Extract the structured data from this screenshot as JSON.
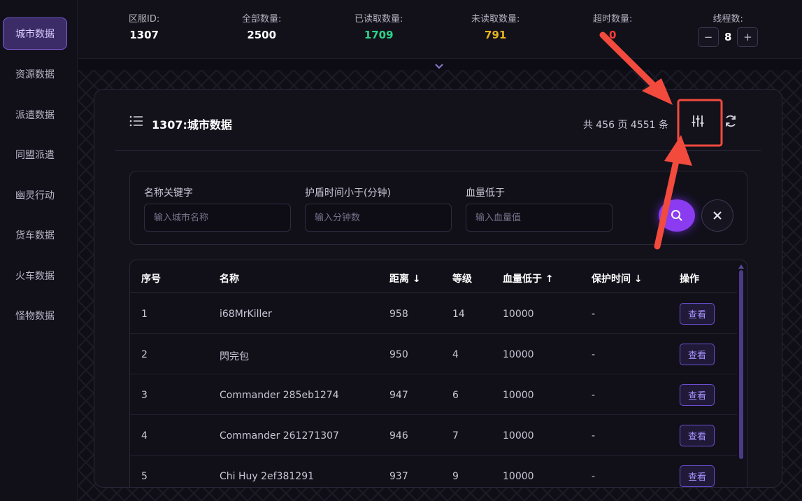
{
  "sidebar": {
    "items": [
      {
        "label": "城市数据",
        "active": true
      },
      {
        "label": "资源数据"
      },
      {
        "label": "派遣数据"
      },
      {
        "label": "同盟派遣"
      },
      {
        "label": "幽灵行动"
      },
      {
        "label": "货车数据"
      },
      {
        "label": "火车数据"
      },
      {
        "label": "怪物数据"
      }
    ]
  },
  "stats": {
    "server_id": {
      "label": "区服ID:",
      "value": "1307"
    },
    "total": {
      "label": "全部数量:",
      "value": "2500"
    },
    "read": {
      "label": "已读取数量:",
      "value": "1709"
    },
    "unread": {
      "label": "未读取数量:",
      "value": "791"
    },
    "timeout": {
      "label": "超时数量:",
      "value": "0"
    },
    "threads": {
      "label": "线程数:",
      "value": "8",
      "minus": "−",
      "plus": "+"
    }
  },
  "card": {
    "title": "1307:城市数据",
    "pager_info": "共 456 页 4551 条"
  },
  "filters": {
    "name": {
      "label": "名称关键字",
      "placeholder": "输入城市名称"
    },
    "shield": {
      "label": "护盾时间小于(分钟)",
      "placeholder": "输入分钟数"
    },
    "hp": {
      "label": "血量低于",
      "placeholder": "输入血量值"
    }
  },
  "table": {
    "headers": {
      "index": "序号",
      "name": "名称",
      "distance": "距离 ↓",
      "level": "等级",
      "hp": "血量低于 ↑",
      "shield": "保护时间 ↓",
      "action": "操作"
    },
    "rows": [
      {
        "index": "1",
        "name": "i68MrKiller",
        "distance": "958",
        "level": "14",
        "hp": "10000",
        "shield": "-",
        "action": "查看"
      },
      {
        "index": "2",
        "name": "閃完包",
        "distance": "950",
        "level": "4",
        "hp": "10000",
        "shield": "-",
        "action": "查看"
      },
      {
        "index": "3",
        "name": "Commander 285eb1274",
        "distance": "947",
        "level": "6",
        "hp": "10000",
        "shield": "-",
        "action": "查看"
      },
      {
        "index": "4",
        "name": "Commander 261271307",
        "distance": "946",
        "level": "7",
        "hp": "10000",
        "shield": "-",
        "action": "查看"
      },
      {
        "index": "5",
        "name": "Chi Huy 2ef381291",
        "distance": "937",
        "level": "9",
        "hp": "10000",
        "shield": "-",
        "action": "查看"
      }
    ]
  },
  "colors": {
    "accent": "#8b3cf0",
    "annotation": "#f24a3d",
    "read_green": "#2ed28a",
    "unread_yellow": "#e8b321",
    "timeout_red": "#ff3b3b"
  },
  "icons": {
    "title": "list-icon",
    "filter": "sliders-icon",
    "refresh": "refresh-icon",
    "search": "search-icon",
    "clear": "close-icon",
    "collapse": "chevron-down-icon"
  }
}
